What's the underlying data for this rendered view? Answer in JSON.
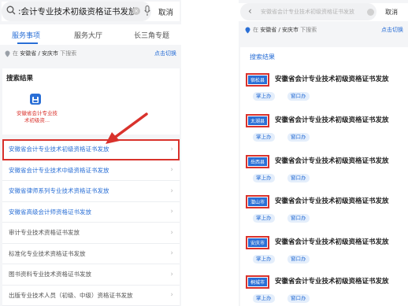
{
  "left": {
    "search": {
      "query": ":会计专业技术初级资格证书发放",
      "cancel": "取消"
    },
    "tabs": [
      {
        "label": "服务事项",
        "active": true
      },
      {
        "label": "服务大厅",
        "active": false
      },
      {
        "label": "长三角专题",
        "active": false
      }
    ],
    "location": {
      "province": "安徽省 / 安庆市",
      "suffix": "下搜索",
      "prefix": "在",
      "switch": "点击切换"
    },
    "results": {
      "title": "搜索结果",
      "app_label": "安徽省会计专业技术初级资...",
      "icon": "save-icon"
    },
    "list": [
      {
        "text": "安徽省会计专业技术初级资格证书发放",
        "tail": "",
        "highlight": true
      },
      {
        "text": "安徽省会计专业技术中级资格证书发放",
        "tail": "",
        "highlight": false
      },
      {
        "text": "安徽省律师系列专业技术资格证书发放",
        "tail": "",
        "highlight": false
      },
      {
        "text": "安徽省高级会计师资格证书发放",
        "tail": "",
        "highlight": false
      },
      {
        "text": "审计专业技术资格证书发放",
        "tail": "",
        "highlight": false
      },
      {
        "text": "标准化专业技术资格证书发放",
        "tail": "",
        "highlight": false
      },
      {
        "text": "图书资料专业技术资格证书发放",
        "tail": "",
        "highlight": false
      },
      {
        "text": "出版专业技术人员（初级、中级）资格证书发放",
        "tail": "",
        "highlight": false
      }
    ]
  },
  "right": {
    "search": {
      "query": "安徽省会计专业技术初级资格证书发放",
      "cancel": "取消"
    },
    "location": {
      "prefix": "在",
      "province": "安徽省 / 安庆市",
      "suffix": "下搜索",
      "switch": "点击切换"
    },
    "results_title": "搜索结果",
    "items": [
      {
        "city": "宿松县",
        "name": "安徽省会计专业技术初级资格证书发放",
        "tags": [
          "掌上办",
          "窗口办"
        ]
      },
      {
        "city": "太湖县",
        "name": "安徽省会计专业技术初级资格证书发放",
        "tags": [
          "掌上办",
          "窗口办"
        ]
      },
      {
        "city": "岳西县",
        "name": "安徽省会计专业技术初级资格证书发放",
        "tags": [
          "掌上办",
          "窗口办"
        ]
      },
      {
        "city": "潜山市",
        "name": "安徽省会计专业技术初级资格证书发放",
        "tags": [
          "掌上办",
          "窗口办"
        ]
      },
      {
        "city": "安庆市",
        "name": "安徽省会计专业技术初级资格证书发放",
        "tags": [
          "掌上办",
          "窗口办"
        ]
      },
      {
        "city": "桐城市",
        "name": "安徽省会计专业技术初级资格证书发放",
        "tags": [
          "掌上办",
          "窗口办"
        ]
      }
    ]
  },
  "colors": {
    "accent": "#2a6fd6",
    "highlight": "#d9322c"
  }
}
